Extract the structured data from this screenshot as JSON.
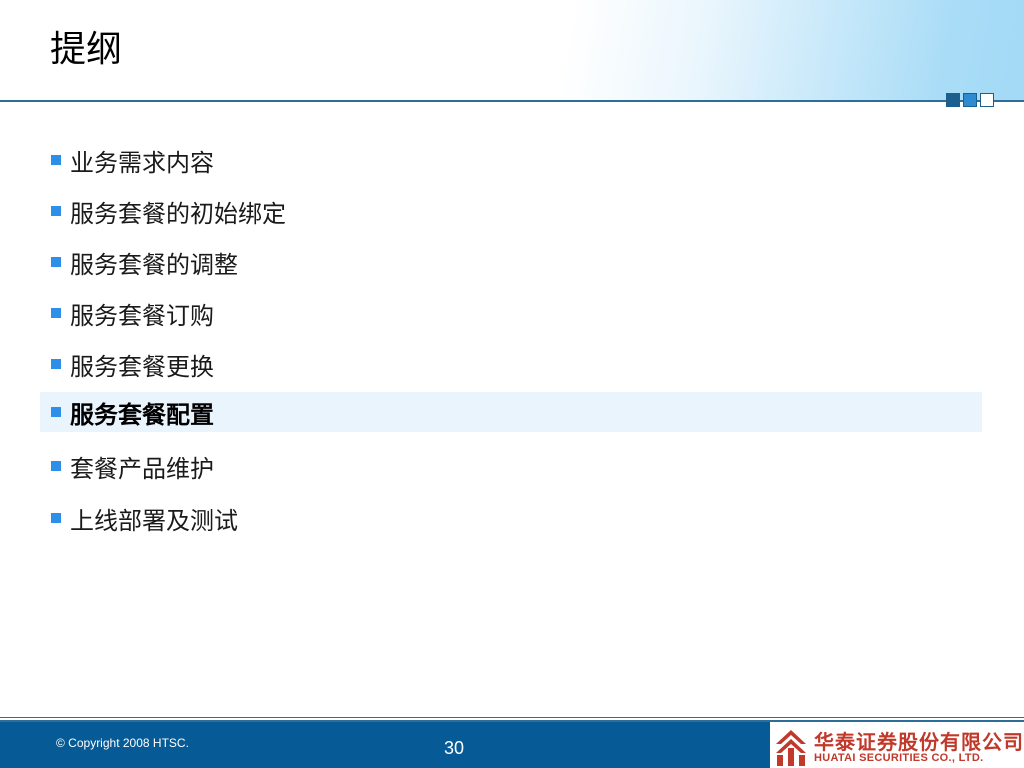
{
  "slide": {
    "title": "提纲",
    "items": [
      {
        "label": "业务需求内容",
        "highlighted": false
      },
      {
        "label": "服务套餐的初始绑定",
        "highlighted": false
      },
      {
        "label": "服务套餐的调整",
        "highlighted": false
      },
      {
        "label": "服务套餐订购",
        "highlighted": false
      },
      {
        "label": "服务套餐更换",
        "highlighted": false
      },
      {
        "label": "服务套餐配置",
        "highlighted": true
      },
      {
        "label": "套餐产品维护",
        "highlighted": false
      },
      {
        "label": "上线部署及测试",
        "highlighted": false
      }
    ]
  },
  "footer": {
    "copyright": "© Copyright 2008 HTSC.",
    "page_number": "30",
    "company_cn": "华泰证券股份有限公司",
    "company_en": "HUATAI SECURITIES CO., LTD."
  },
  "colors": {
    "accent_blue": "#065a96",
    "bullet_blue": "#2d8fe8",
    "highlight_bg": "#eaf4fd",
    "logo_red": "#c0392b"
  }
}
